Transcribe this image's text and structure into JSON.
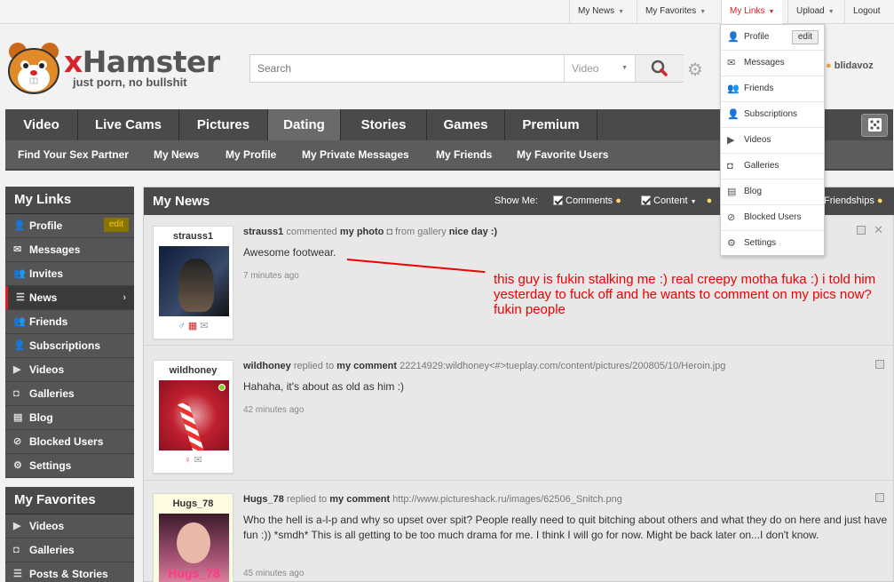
{
  "topbar": {
    "my_news": "My News",
    "my_favorites": "My Favorites",
    "my_links": "My Links",
    "upload": "Upload",
    "logout": "Logout"
  },
  "logo": {
    "x": "x",
    "name": "Hamster",
    "tagline": "just porn, no bullshit"
  },
  "search": {
    "placeholder": "Search",
    "category": "Video"
  },
  "user": {
    "name": "blidavoz"
  },
  "mainnav": [
    "Video",
    "Live Cams",
    "Pictures",
    "Dating",
    "Stories",
    "Games",
    "Premium"
  ],
  "subnav": [
    "Find Your Sex Partner",
    "My News",
    "My Profile",
    "My Private Messages",
    "My Friends",
    "My Favorite Users"
  ],
  "sidebar": {
    "links_title": "My Links",
    "edit": "edit",
    "links": [
      {
        "label": "Profile",
        "icon": "user-icon"
      },
      {
        "label": "Messages",
        "icon": "envelope-icon"
      },
      {
        "label": "Invites",
        "icon": "invite-icon"
      },
      {
        "label": "News",
        "icon": "news-icon"
      },
      {
        "label": "Friends",
        "icon": "friends-icon"
      },
      {
        "label": "Subscriptions",
        "icon": "subscriptions-icon"
      },
      {
        "label": "Videos",
        "icon": "video-camera-icon"
      },
      {
        "label": "Galleries",
        "icon": "camera-icon"
      },
      {
        "label": "Blog",
        "icon": "blog-icon"
      },
      {
        "label": "Blocked Users",
        "icon": "block-icon"
      },
      {
        "label": "Settings",
        "icon": "gear-icon"
      }
    ],
    "fav_title": "My Favorites",
    "favs": [
      {
        "label": "Videos",
        "icon": "video-camera-icon"
      },
      {
        "label": "Galleries",
        "icon": "camera-icon"
      },
      {
        "label": "Posts & Stories",
        "icon": "news-icon"
      }
    ]
  },
  "panel": {
    "title": "My News",
    "show_me": "Show Me:",
    "comments": "Comments",
    "content": "Content",
    "friendships": "Friendships"
  },
  "feed": [
    {
      "user": "strauss1",
      "action": "commented",
      "target": "my photo",
      "from": "from gallery",
      "gallery": "nice day :)",
      "body": "Awesome footwear.",
      "time": "7 minutes ago"
    },
    {
      "user": "wildhoney",
      "action": "replied to",
      "target": "my comment",
      "extra": "22214929:wildhoney<#>tueplay.com/content/pictures/200805/10/Heroin.jpg",
      "body": "Hahaha, it's about as old as him :)",
      "time": "42 minutes ago"
    },
    {
      "user": "Hugs_78",
      "action": "replied to",
      "target": "my comment",
      "extra": "http://www.pictureshack.ru/images/62506_Snitch.png",
      "body": "Who the hell is a-l-p and why so upset over spit? People really need to quit bitching about others and what they do on here and just have fun :)) *smdh* This is all getting to be too much drama for me. I think I will go for now. Might be back later on...I don't know.",
      "time": "45 minutes ago",
      "img_text": "Hugs_78"
    }
  ],
  "annotation": "this guy is fukin stalking me :) real creepy motha fuka :) i told him yesterday to fuck off and he wants to comment on my pics now? fukin people",
  "dropdown": {
    "edit": "edit",
    "items": [
      {
        "label": "Profile",
        "icon": "user-icon"
      },
      {
        "label": "Messages",
        "icon": "envelope-icon"
      },
      {
        "label": "Friends",
        "icon": "friends-icon"
      },
      {
        "label": "Subscriptions",
        "icon": "subscriptions-icon"
      },
      {
        "label": "Videos",
        "icon": "video-camera-icon"
      },
      {
        "label": "Galleries",
        "icon": "camera-icon"
      },
      {
        "label": "Blog",
        "icon": "blog-icon"
      },
      {
        "label": "Blocked Users",
        "icon": "block-icon"
      },
      {
        "label": "Settings",
        "icon": "gear-icon"
      }
    ]
  },
  "colors": {
    "accent": "#d8222a",
    "nav": "#4a4a4a",
    "annotation": "#ee0000"
  }
}
